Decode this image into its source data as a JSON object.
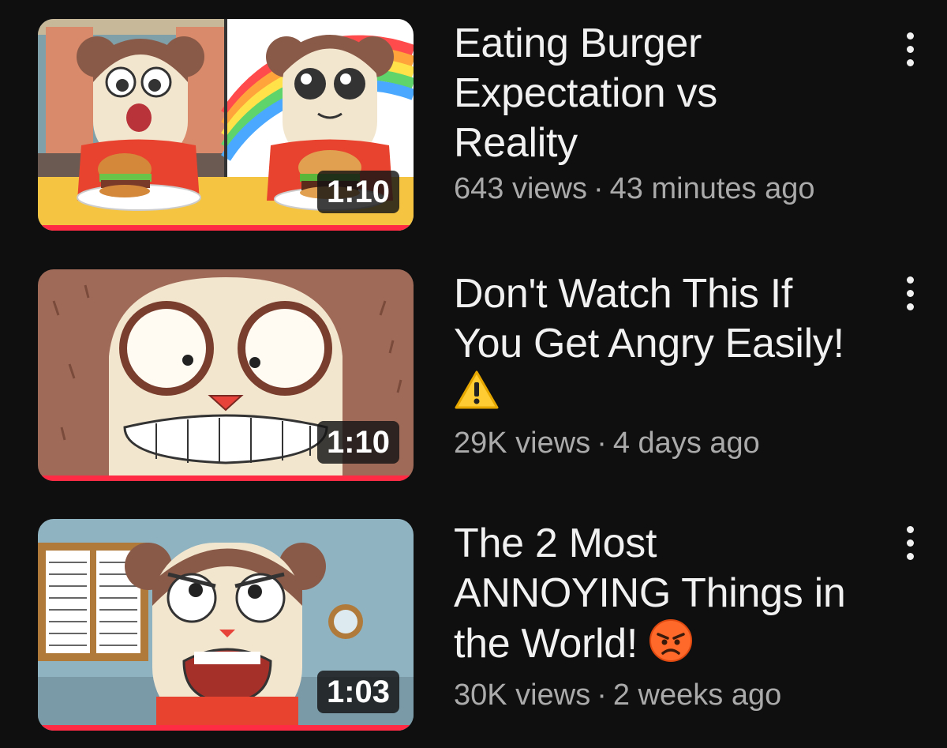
{
  "videos": [
    {
      "title": "Eating Burger\nExpectation vs\nReality",
      "views": "643 views",
      "age": "43 minutes ago",
      "duration": "1:10",
      "progress_fraction": 1.0,
      "title_emoji": ""
    },
    {
      "title": "Don't Watch This If\nYou Get Angry Easily!",
      "views": "29K views",
      "age": "4 days ago",
      "duration": "1:10",
      "progress_fraction": 1.0,
      "title_emoji": "warning-icon"
    },
    {
      "title": "The 2 Most\nANNOYING Things in\nthe World!",
      "views": "30K views",
      "age": "2 weeks ago",
      "duration": "1:03",
      "progress_fraction": 1.0,
      "title_emoji": "angry-face-icon"
    }
  ],
  "separator": "·",
  "colors": {
    "background": "#0f0f0f",
    "progress": "#ff2a44",
    "meta_text": "#aaaaaa",
    "title_text": "#f1f1f1"
  }
}
